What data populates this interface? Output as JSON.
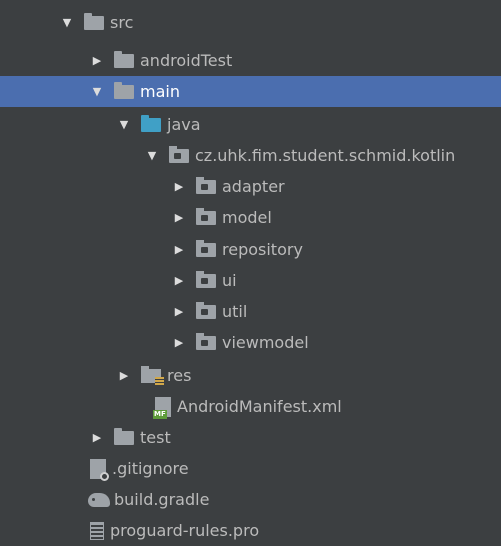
{
  "tree": [
    {
      "label": "src",
      "arrow": "▼",
      "icon": "folder-icon"
    },
    {
      "label": "androidTest",
      "arrow": "▶",
      "icon": "folder-icon"
    },
    {
      "label": "main",
      "arrow": "▼",
      "icon": "folder-icon",
      "selected": true
    },
    {
      "label": "java",
      "arrow": "▼",
      "icon": "source-folder-icon"
    },
    {
      "label": "cz.uhk.fim.student.schmid.kotlin",
      "arrow": "▼",
      "icon": "package-icon"
    },
    {
      "label": "adapter",
      "arrow": "▶",
      "icon": "package-icon"
    },
    {
      "label": "model",
      "arrow": "▶",
      "icon": "package-icon"
    },
    {
      "label": "repository",
      "arrow": "▶",
      "icon": "package-icon"
    },
    {
      "label": "ui",
      "arrow": "▶",
      "icon": "package-icon"
    },
    {
      "label": "util",
      "arrow": "▶",
      "icon": "package-icon"
    },
    {
      "label": "viewmodel",
      "arrow": "▶",
      "icon": "package-icon"
    },
    {
      "label": "res",
      "arrow": "▶",
      "icon": "resources-folder-icon"
    },
    {
      "label": "AndroidManifest.xml",
      "arrow": "",
      "icon": "manifest-file-icon"
    },
    {
      "label": "test",
      "arrow": "▶",
      "icon": "folder-icon"
    },
    {
      "label": ".gitignore",
      "arrow": "",
      "icon": "gitignore-file-icon"
    },
    {
      "label": "build.gradle",
      "arrow": "",
      "icon": "gradle-file-icon"
    },
    {
      "label": "proguard-rules.pro",
      "arrow": "",
      "icon": "text-file-icon"
    }
  ],
  "colors": {
    "background": "#3c3f41",
    "selection": "#4b6eaf",
    "text": "#bbbbbb",
    "source_folder": "#40a0c6"
  }
}
